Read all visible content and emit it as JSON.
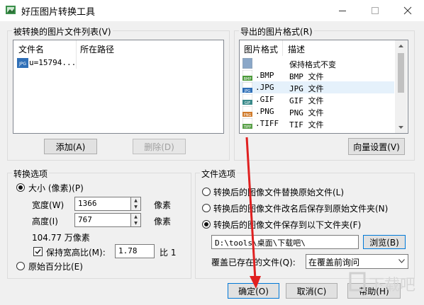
{
  "window": {
    "title": "好压图片转换工具",
    "accent": "#0078d7"
  },
  "file_list": {
    "label": "被转换的图片文件列表(V)",
    "columns": [
      "文件名",
      "所在路径"
    ],
    "rows": [
      {
        "icon": "jpg-file-icon",
        "badge": "JPG",
        "name": "u=15794...",
        "path": ""
      }
    ],
    "add_label": "添加(A)",
    "delete_label": "删除(D)"
  },
  "export_formats": {
    "label": "导出的图片格式(R)",
    "columns": [
      "图片格式",
      "描述"
    ],
    "rows": [
      {
        "ext": "",
        "desc": "保持格式不变",
        "badge": "",
        "color": "#8aa7c8"
      },
      {
        "ext": ".BMP",
        "desc": "BMP 文件",
        "badge": "BMP",
        "color": "#4c9a3a"
      },
      {
        "ext": ".JPG",
        "desc": "JPG 文件",
        "badge": "JPG",
        "color": "#2f6fb7"
      },
      {
        "ext": ".GIF",
        "desc": "GIF 文件",
        "badge": "GIF",
        "color": "#3a8a8a"
      },
      {
        "ext": ".PNG",
        "desc": "PNG 文件",
        "badge": "PNG",
        "color": "#d07a2a"
      },
      {
        "ext": ".TIFF",
        "desc": "TIF 文件",
        "badge": "TIFF",
        "color": "#5aa04a"
      }
    ],
    "selected_index": 2,
    "wizard_label": "向量设置(V)"
  },
  "convert_options": {
    "label": "转换选项",
    "size_label": "大小 (像素)(P)",
    "width_label": "宽度(W)",
    "width_value": "1366",
    "height_label": "高度(I)",
    "height_value": "767",
    "unit": "像素",
    "megapixels": "104.77 万像素",
    "keep_ratio_label": "保持宽高比(M):",
    "ratio_value": "1.78",
    "ratio_suffix": "比 1",
    "percent_label": "原始百分比(E)"
  },
  "file_options": {
    "label": "文件选项",
    "opt1": "转换后的图像文件替换原始文件(L)",
    "opt2": "转换后的图像文件改名后保存到原始文件夹(N)",
    "opt3": "转换后的图像文件保存到以下文件夹(F)",
    "selected": 3,
    "folder_value": "D:\\tools\\桌面\\下载吧\\",
    "browse_label": "浏览(B)",
    "overwrite_label": "覆盖已存在的文件(Q):",
    "overwrite_value": "在覆盖前询问"
  },
  "footer": {
    "ok_label": "确定(O)",
    "cancel_label": "取消(C)",
    "help_label": "帮助(H)"
  }
}
